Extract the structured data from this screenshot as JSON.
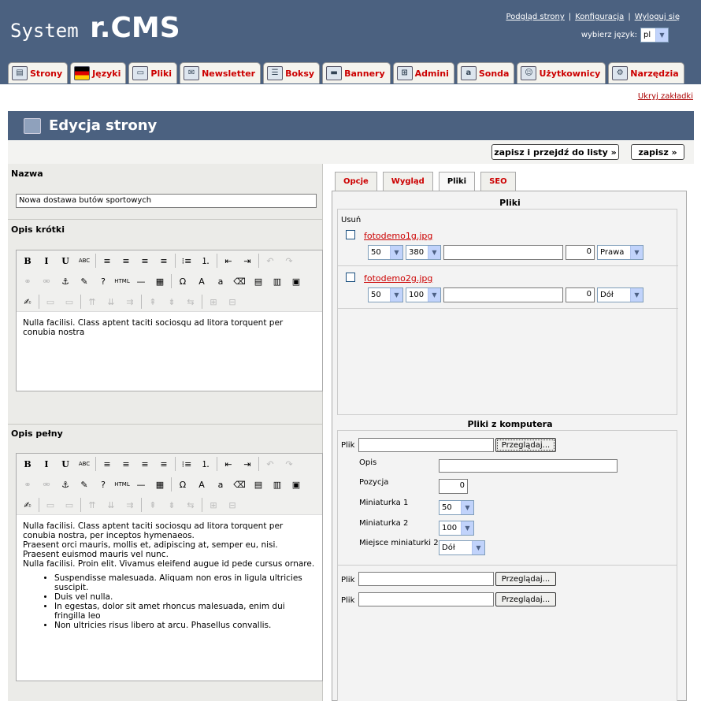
{
  "header": {
    "logo_system": "System ",
    "logo_rcms": "r.CMS",
    "links": [
      "Podgląd strony",
      "Konfiguracja",
      "Wyloguj się"
    ],
    "lang_label": "wybierz język:",
    "lang_value": "pl"
  },
  "nav_tabs": [
    {
      "label": "Strony",
      "icon": "pages-icon"
    },
    {
      "label": "Języki",
      "icon": "flag-icon"
    },
    {
      "label": "Pliki",
      "icon": "folder-icon"
    },
    {
      "label": "Newsletter",
      "icon": "newsletter-icon"
    },
    {
      "label": "Boksy",
      "icon": "boxes-icon"
    },
    {
      "label": "Bannery",
      "icon": "banner-icon"
    },
    {
      "label": "Admini",
      "icon": "admins-icon"
    },
    {
      "label": "Sonda",
      "icon": "poll-icon"
    },
    {
      "label": "Użytkownicy",
      "icon": "users-icon"
    },
    {
      "label": "Narzędzia",
      "icon": "gear-icon"
    }
  ],
  "hide_tabs": "Ukryj zakładki",
  "page_title": "Edycja strony",
  "buttons": {
    "save_and_list": "zapisz i przejdź do listy »",
    "save": "zapisz »"
  },
  "form": {
    "name_label": "Nazwa",
    "name_value": "Nowa dostawa butów sportowych",
    "short_label": "Opis krótki",
    "short_text": "Nulla facilisi. Class aptent taciti sociosqu ad litora torquent per conubia nostra",
    "full_label": "Opis pełny",
    "full_paragraphs": [
      "Nulla facilisi. Class aptent taciti sociosqu ad litora torquent per conubia nostra, per inceptos hymenaeos.",
      "Praesent orci mauris, mollis et, adipiscing at, semper eu, nisi. Praesent euismod mauris vel nunc.",
      "Nulla facilisi. Proin elit. Vivamus eleifend augue id pede cursus ornare."
    ],
    "full_list": [
      "Suspendisse malesuada. Aliquam non eros in ligula ultricies suscipit.",
      "Duis vel nulla.",
      "In egestas, dolor sit amet rhoncus malesuada, enim dui fringilla leo",
      "Non ultricies risus libero at arcu. Phasellus convallis."
    ]
  },
  "right_tabs": [
    "Opcje",
    "Wygląd",
    "Pliki",
    "SEO"
  ],
  "files": {
    "title": "Pliki",
    "delete_label": "Usuń",
    "items": [
      {
        "name": "fotodemo1g.jpg",
        "w": "50",
        "h": "380",
        "desc": "",
        "pos": "0",
        "place": "Prawa"
      },
      {
        "name": "fotodemo2g.jpg",
        "w": "50",
        "h": "100",
        "desc": "",
        "pos": "0",
        "place": "Dół"
      }
    ]
  },
  "upload": {
    "title": "Pliki z komputera",
    "file_label": "Plik",
    "browse_label": "Przeglądaj...",
    "opis_label": "Opis",
    "pozycja_label": "Pozycja",
    "pozycja_value": "0",
    "mini1_label": "Miniaturka 1",
    "mini1_value": "50",
    "mini2_label": "Miniaturka 2",
    "mini2_value": "100",
    "place_label": "Miejsce miniaturki 2",
    "place_value": "Dół"
  },
  "toolbar_icons": [
    "bold-icon",
    "italic-icon",
    "underline-icon",
    "strikethrough-icon",
    "align-left-icon",
    "align-center-icon",
    "align-right-icon",
    "justify-icon",
    "bullet-list-icon",
    "numbered-list-icon",
    "outdent-icon",
    "indent-icon",
    "undo-icon",
    "redo-icon"
  ],
  "toolbar_glyphs": {
    "bold": "B",
    "italic": "I",
    "underline": "U",
    "strike": "ABC",
    "html": "HTML",
    "omega": "Ω",
    "font_color": "A"
  }
}
